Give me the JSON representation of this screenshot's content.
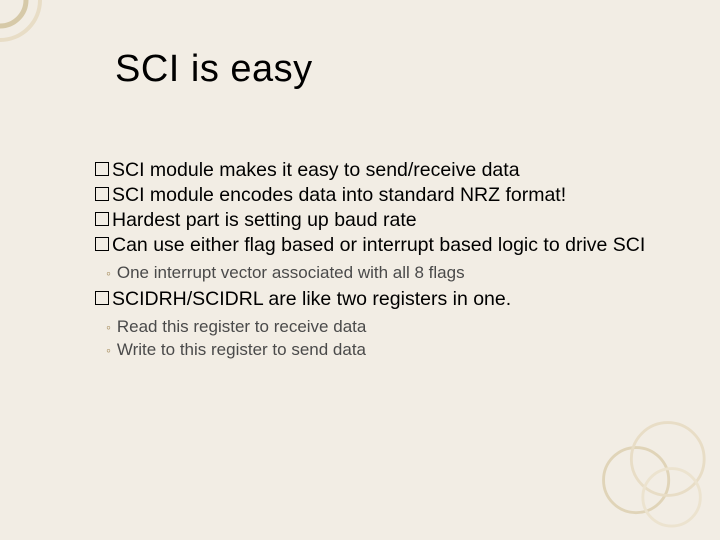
{
  "title": "SCI is easy",
  "bullets": {
    "b0": "SCI module makes it easy to send/receive data",
    "b1": "SCI module encodes data into standard NRZ format!",
    "b2": "Hardest part is setting up baud rate",
    "b3": "Can use either flag based or interrupt based logic to drive SCI",
    "b4": "SCIDRH/SCIDRL are like two registers in one."
  },
  "sub": {
    "s0": "One interrupt vector associated with all 8 flags",
    "s1": "Read this register to receive data",
    "s2": "Write to this register to send data"
  }
}
